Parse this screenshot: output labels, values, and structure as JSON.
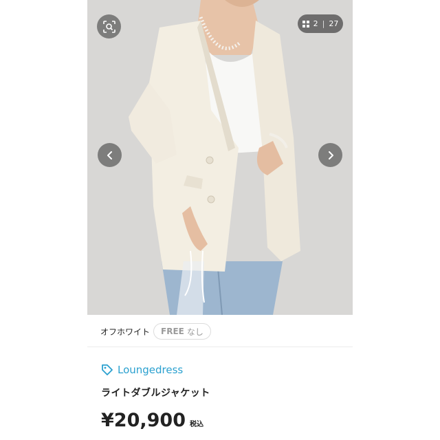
{
  "gallery": {
    "counter_current": "2",
    "counter_separator": "|",
    "counter_total": "27",
    "icons": {
      "search": "search-lens-icon",
      "grid": "grid-icon",
      "prev": "chevron-left-icon",
      "next": "chevron-right-icon"
    }
  },
  "attributes": {
    "color": "オフホワイト",
    "size": "FREE",
    "stock": "なし"
  },
  "product": {
    "brand": "Loungedress",
    "brand_icon": "tag-icon",
    "brand_color": "#2aa0cf",
    "title": "ライトダブルジャケット",
    "price": "¥20,900",
    "tax_label": "税込"
  }
}
